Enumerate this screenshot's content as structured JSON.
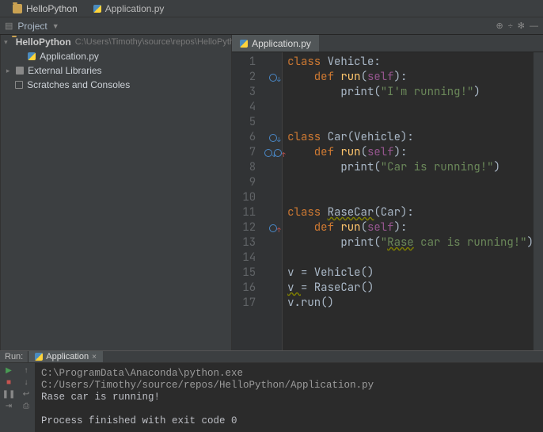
{
  "tabs_top": {
    "project_label": "HelloPython",
    "file_label": "Application.py"
  },
  "toolstrip": {
    "project_label": "Project"
  },
  "tree": {
    "root_name": "HelloPython",
    "root_path": "C:\\Users\\Timothy\\source\\repos\\HelloPython",
    "file1": "Application.py",
    "ext_lib": "External Libraries",
    "scratches": "Scratches and Consoles"
  },
  "editor": {
    "tab_label": "Application.py",
    "lines": {
      "l1": [
        "class ",
        "Vehicle",
        ":"
      ],
      "l2": [
        "def ",
        "run",
        "(self):"
      ],
      "l3": [
        "print",
        "(",
        "\"I'm running!\"",
        ")"
      ],
      "l6": [
        "class ",
        "Car",
        "(Vehicle):"
      ],
      "l7": [
        "def ",
        "run",
        "(self):"
      ],
      "l8": [
        "print",
        "(",
        "\"Car is running!\"",
        ")"
      ],
      "l11": [
        "class ",
        "RaseCar",
        "(Car):"
      ],
      "l12": [
        "def ",
        "run",
        "(self):"
      ],
      "l13": [
        "print",
        "(",
        "\"",
        "Rase",
        " car is running!\"",
        ")"
      ],
      "l15": "v = Vehicle()",
      "l16p": "v ",
      "l16s": "= RaseCar()",
      "l17": "v.run()"
    }
  },
  "run": {
    "label": "Run:",
    "tab": "Application",
    "cmd": "C:\\ProgramData\\Anaconda\\python.exe C:/Users/Timothy/source/repos/HelloPython/Application.py",
    "out": "Rase car is running!",
    "exit": "Process finished with exit code 0"
  }
}
